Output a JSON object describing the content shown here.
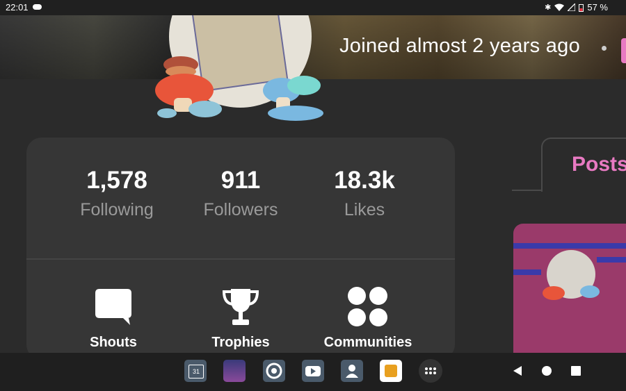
{
  "status_bar": {
    "time": "22:01",
    "battery": "57 %",
    "icons": [
      "cloud-icon",
      "bluetooth-icon",
      "wifi-icon",
      "signal-icon",
      "battery-icon"
    ]
  },
  "profile": {
    "joined": "Joined almost 2 years ago",
    "accent": "#e87ac2"
  },
  "stats": [
    {
      "value": "1,578",
      "label": "Following"
    },
    {
      "value": "911",
      "label": "Followers"
    },
    {
      "value": "18.3k",
      "label": "Likes"
    }
  ],
  "actions": [
    {
      "label": "Shouts",
      "icon": "chat-bubble-icon"
    },
    {
      "label": "Trophies",
      "icon": "trophy-icon"
    },
    {
      "label": "Communities",
      "icon": "four-circles-icon"
    }
  ],
  "tabs": {
    "posts": "Posts"
  },
  "taskbar": {
    "apps": [
      "calendar-icon",
      "game-app-icon",
      "chrome-icon",
      "youtube-icon",
      "contacts-icon",
      "amino-app-icon",
      "app-drawer-icon"
    ],
    "calendar_day": "31"
  },
  "nav": [
    "back-icon",
    "home-icon",
    "recents-icon"
  ]
}
